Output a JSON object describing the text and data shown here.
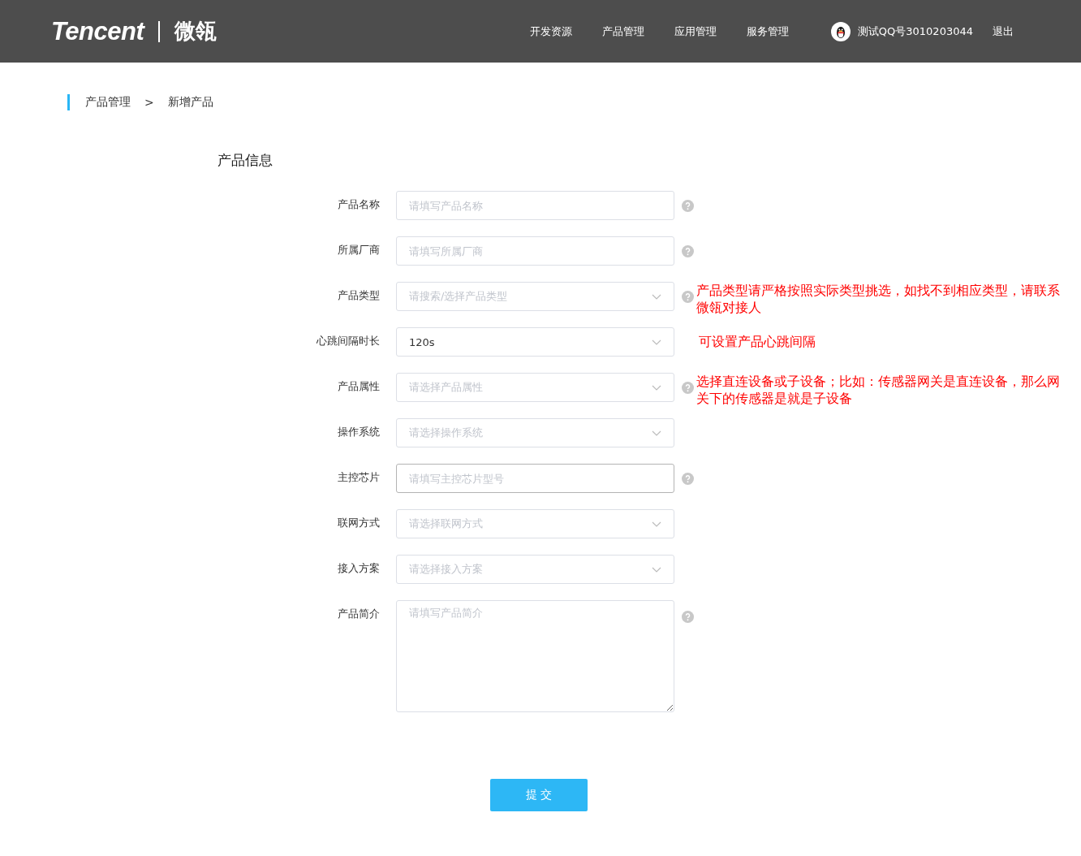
{
  "header": {
    "logo": "Tencent",
    "product": "微瓴",
    "nav": [
      "开发资源",
      "产品管理",
      "应用管理",
      "服务管理"
    ],
    "user": "测试QQ号3010203044",
    "logout": "退出"
  },
  "breadcrumb": [
    "产品管理",
    ">",
    "新增产品"
  ],
  "section_title": "产品信息",
  "fields": [
    {
      "label": "产品名称",
      "kind": "text",
      "placeholder": "请填写产品名称",
      "help": true,
      "focused": false
    },
    {
      "label": "所属厂商",
      "kind": "text",
      "placeholder": "请填写所属厂商",
      "help": true,
      "focused": false
    },
    {
      "label": "产品类型",
      "kind": "select",
      "placeholder": "请搜索/选择产品类型",
      "help": true,
      "focused": false,
      "note": "产品类型请严格按照实际类型挑选，如找不到相应类型，请联系微瓴对接人"
    },
    {
      "label": "心跳间隔时长",
      "kind": "select",
      "value": "120s",
      "help": false,
      "focused": false,
      "note": "可设置产品心跳间隔"
    },
    {
      "label": "产品属性",
      "kind": "select",
      "placeholder": "请选择产品属性",
      "help": true,
      "focused": false,
      "note": "选择直连设备或子设备；比如：传感器网关是直连设备，那么网关下的传感器是就是子设备"
    },
    {
      "label": "操作系统",
      "kind": "select",
      "placeholder": "请选择操作系统",
      "help": false,
      "focused": false
    },
    {
      "label": "主控芯片",
      "kind": "text",
      "placeholder": "请填写主控芯片型号",
      "help": true,
      "focused": true
    },
    {
      "label": "联网方式",
      "kind": "select",
      "placeholder": "请选择联网方式",
      "help": false,
      "focused": false
    },
    {
      "label": "接入方案",
      "kind": "select",
      "placeholder": "请选择接入方案",
      "help": false,
      "focused": false
    },
    {
      "label": "产品简介",
      "kind": "textarea",
      "placeholder": "请填写产品简介",
      "help": true,
      "focused": false
    }
  ],
  "submit": "提 交"
}
